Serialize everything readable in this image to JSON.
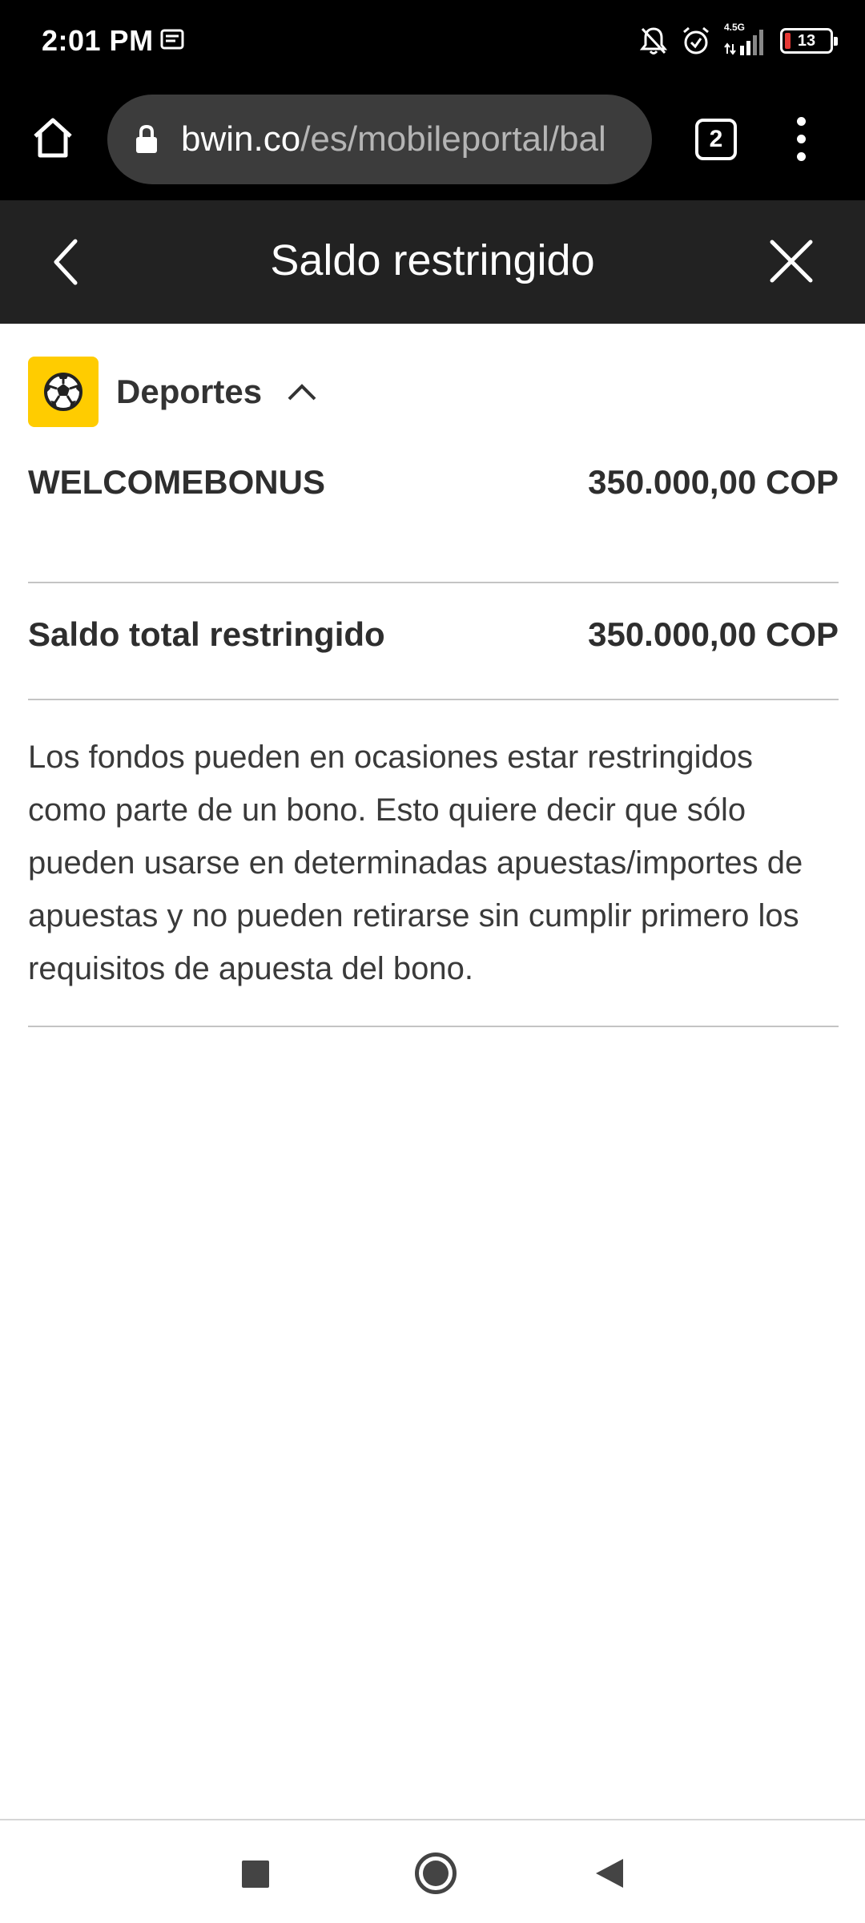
{
  "status_bar": {
    "time": "2:01 PM",
    "network": "4.5G",
    "battery": "13",
    "battery_level": 0.13,
    "icons": [
      "message-icon",
      "bell-off-icon",
      "alarm-icon",
      "signal-icon",
      "battery-icon"
    ]
  },
  "browser": {
    "url_host": "bwin.co",
    "url_path": "/es/mobileportal/bal",
    "tab_count": "2"
  },
  "page": {
    "title": "Saldo restringido"
  },
  "section": {
    "title": "Deportes",
    "icon": "soccer-ball-icon",
    "accent_color": "#ffcc00"
  },
  "balances": {
    "bonus_label": "WELCOMEBONUS",
    "bonus_value": "350.000,00 COP",
    "total_label": "Saldo total restringido",
    "total_value": "350.000,00 COP"
  },
  "info": {
    "text": "Los fondos pueden en ocasiones estar restringidos como parte de un bono. Esto quiere decir que sólo pueden usarse en determinadas apuestas/importes de apuestas y no pueden retirarse sin cumplir primero los requisitos de apuesta del bono."
  }
}
